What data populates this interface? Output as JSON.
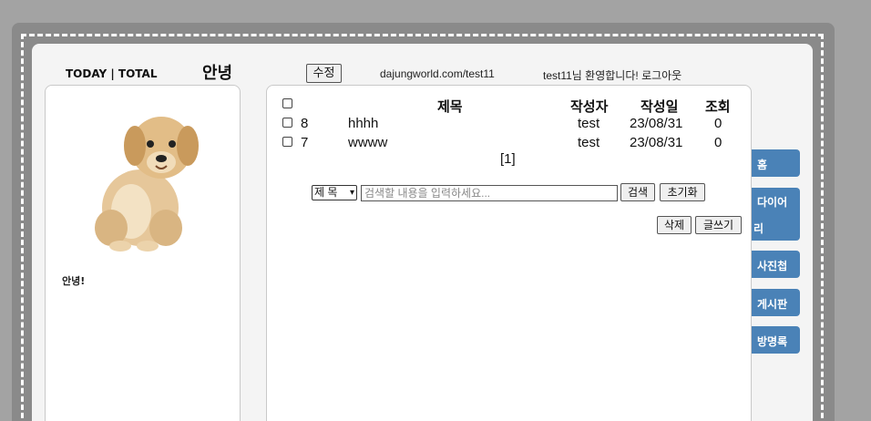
{
  "header": {
    "counter": "TODAY | TOTAL",
    "title": "안녕",
    "edit_label": "수정",
    "url": "dajungworld.com/test11",
    "welcome": "test11님 환영합니다!",
    "logout": "로그아웃"
  },
  "profile": {
    "image": "golden-retriever-puppy",
    "intro": "안녕!"
  },
  "board": {
    "columns": [
      "제목",
      "작성자",
      "작성일",
      "조회"
    ],
    "rows": [
      {
        "no": "8",
        "title": "hhhh",
        "author": "test",
        "date": "23/08/31",
        "views": "0"
      },
      {
        "no": "7",
        "title": "wwww",
        "author": "test",
        "date": "23/08/31",
        "views": "0"
      }
    ],
    "pagination": "[1]",
    "search_type": "제 목",
    "search_placeholder": "검색할 내용을 입력하세요...",
    "search_button": "검색",
    "reset_button": "초기화",
    "delete_button": "삭제",
    "write_button": "글쓰기"
  },
  "nav": {
    "items": [
      "홈",
      "다이어",
      "리",
      "사진첩",
      "게시판",
      "방명록"
    ]
  },
  "colors": {
    "nav_bg": "#4a82b7",
    "frame_outer": "#8a8a8a",
    "page_bg": "#a3a3a3"
  }
}
